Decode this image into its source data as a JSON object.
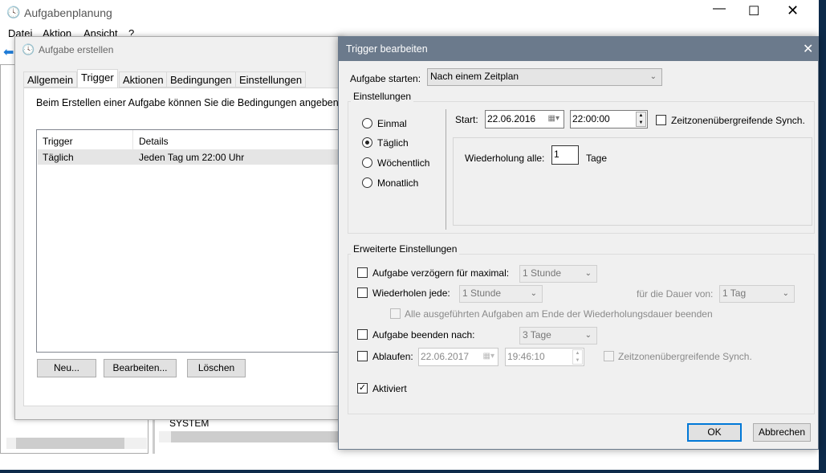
{
  "main_window": {
    "title": "Aufgabenplanung",
    "menu": [
      "Datei",
      "Aktion",
      "Ansicht",
      "?"
    ],
    "bg_text": "SYSTEM"
  },
  "create_dialog": {
    "title": "Aufgabe erstellen",
    "tabs": [
      "Allgemein",
      "Trigger",
      "Aktionen",
      "Bedingungen",
      "Einstellungen"
    ],
    "active_tab": "Trigger",
    "description": "Beim Erstellen einer Aufgabe können Sie die Bedingungen angeben, die",
    "table": {
      "columns": [
        "Trigger",
        "Details"
      ],
      "rows": [
        [
          "Täglich",
          "Jeden Tag um 22:00 Uhr"
        ]
      ]
    },
    "buttons": {
      "new": "Neu...",
      "edit": "Bearbeiten...",
      "delete": "Löschen"
    }
  },
  "trigger_dialog": {
    "title": "Trigger bearbeiten",
    "start_label": "Aufgabe starten:",
    "start_value": "Nach einem Zeitplan",
    "settings_label": "Einstellungen",
    "radios": [
      "Einmal",
      "Täglich",
      "Wöchentlich",
      "Monatlich"
    ],
    "selected_radio": "Täglich",
    "start": "Start:",
    "start_date": "22.06.2016",
    "start_time": "22:00:00",
    "sync_label": "Zeitzonenübergreifende Synch.",
    "sync_checked": false,
    "repeat_label": "Wiederholung alle:",
    "repeat_value": "1",
    "repeat_unit": "Tage",
    "advanced_label": "Erweiterte Einstellungen",
    "delay_label": "Aufgabe verzögern für maximal:",
    "delay_value": "1 Stunde",
    "repeat_every_label": "Wiederholen jede:",
    "repeat_every_value": "1 Stunde",
    "duration_label": "für die Dauer von:",
    "duration_value": "1 Tag",
    "stop_all_label": "Alle ausgeführten Aufgaben am Ende der Wiederholungsdauer beenden",
    "stop_after_label": "Aufgabe beenden nach:",
    "stop_after_value": "3 Tage",
    "expire_label": "Ablaufen:",
    "expire_date": "22.06.2017",
    "expire_time": "19:46:10",
    "expire_sync_label": "Zeitzonenübergreifende Synch.",
    "enabled_label": "Aktiviert",
    "enabled_checked": true,
    "ok": "OK",
    "cancel": "Abbrechen",
    "title_bar_color": "#6b7a8c",
    "accent": "#0078d7"
  }
}
